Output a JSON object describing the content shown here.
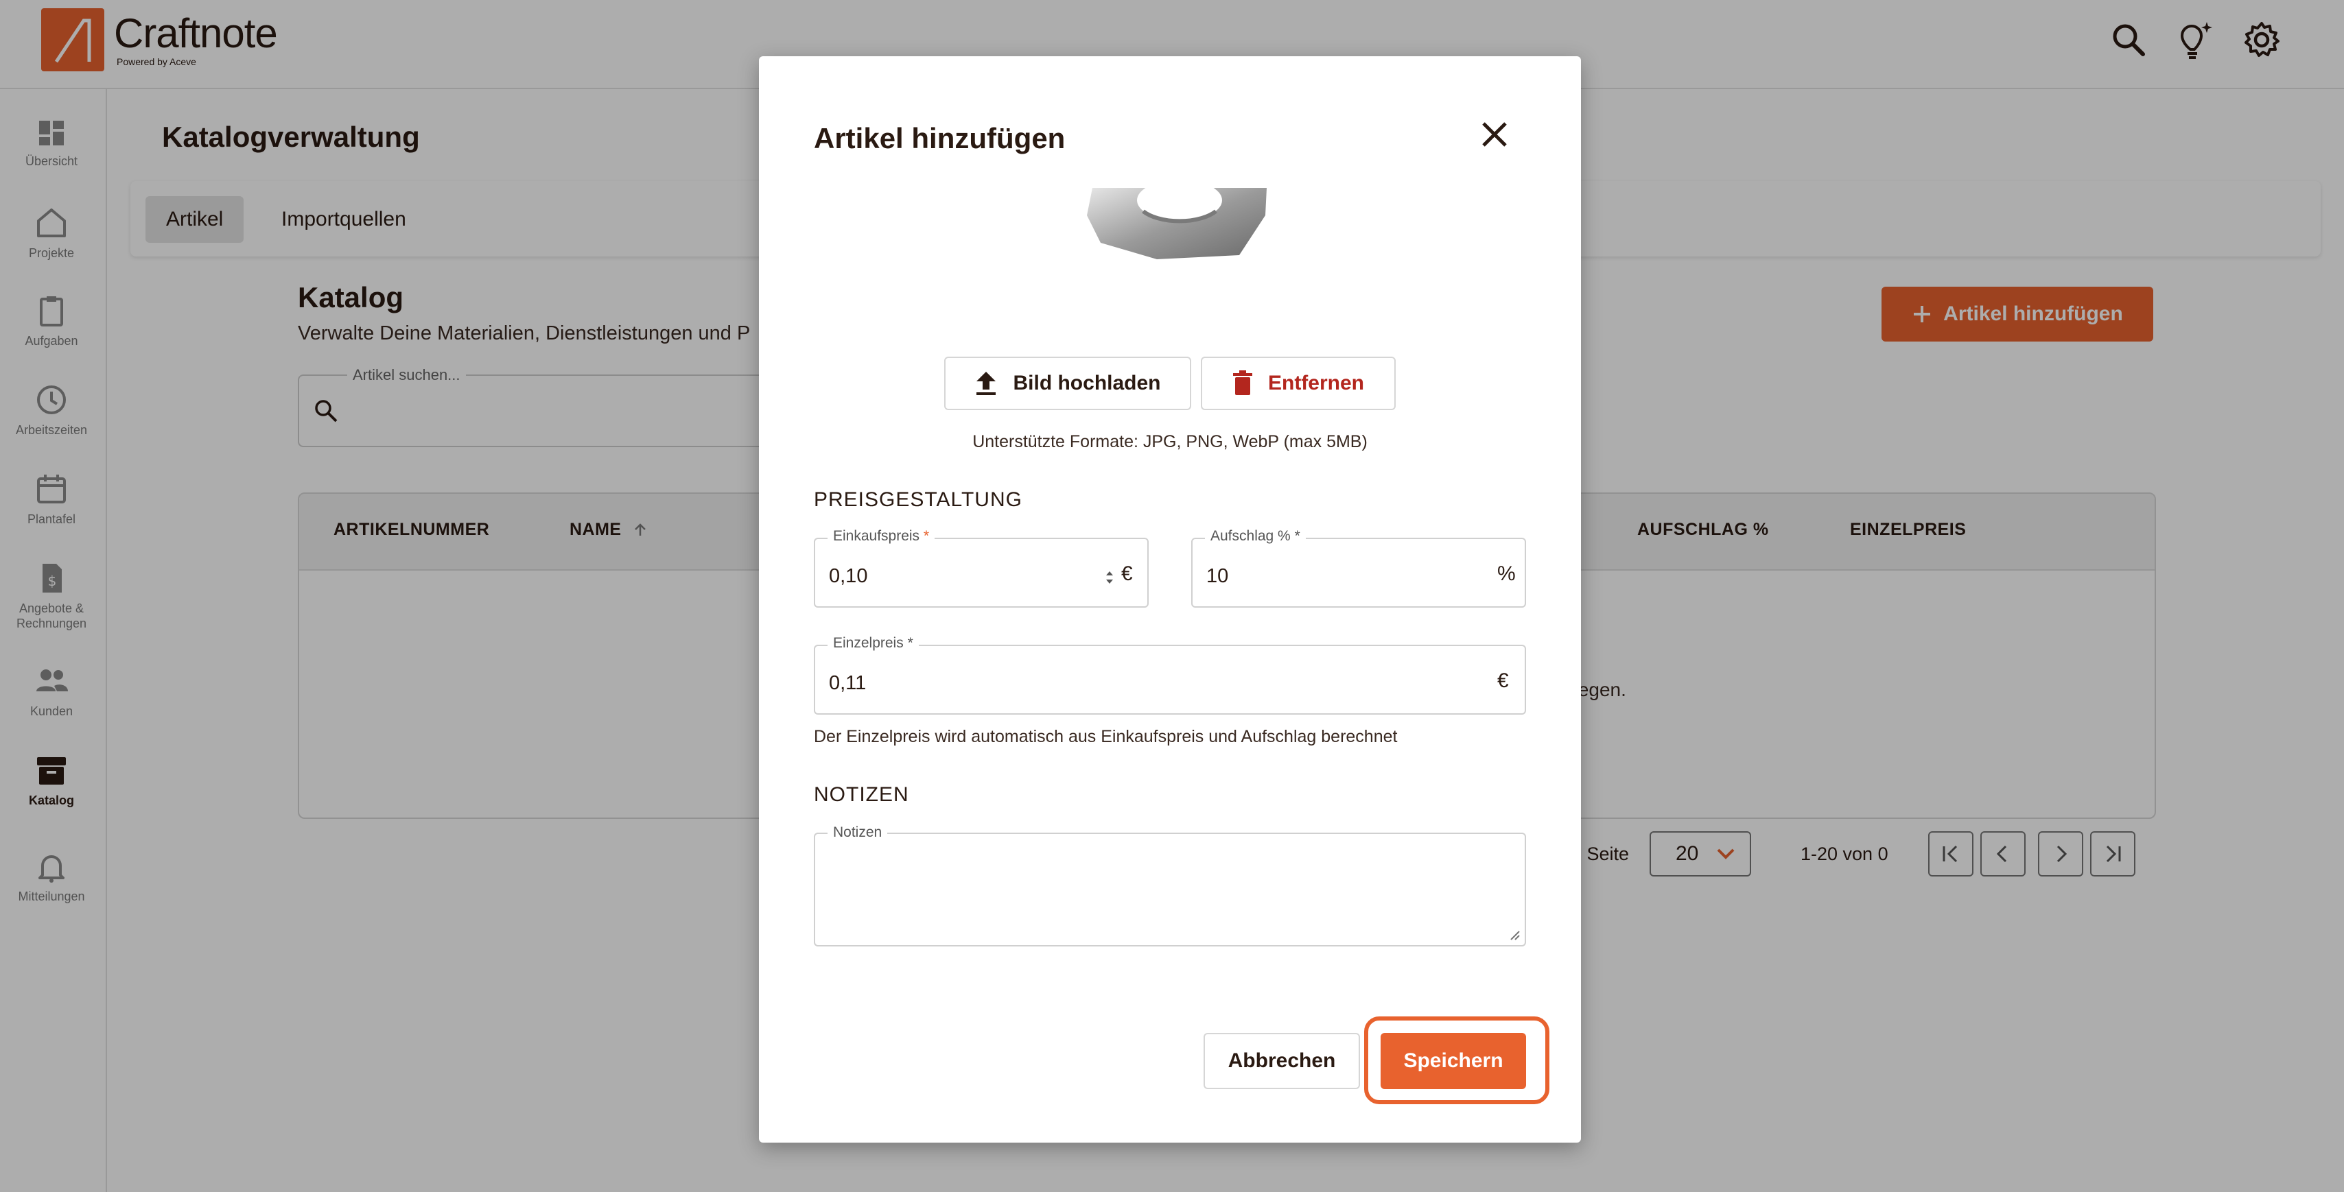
{
  "brand": {
    "name": "Craftnote",
    "tagline": "Powered by Aceve"
  },
  "sidebar": {
    "items": [
      {
        "label": "Übersicht"
      },
      {
        "label": "Projekte"
      },
      {
        "label": "Aufgaben"
      },
      {
        "label": "Arbeitszeiten"
      },
      {
        "label": "Plantafel"
      },
      {
        "label": "Angebote & Rechnungen"
      },
      {
        "label": "Kunden"
      },
      {
        "label": "Katalog",
        "active": true
      },
      {
        "label": "Mitteilungen"
      }
    ]
  },
  "page": {
    "title": "Katalogverwaltung",
    "tabs": [
      {
        "label": "Artikel",
        "active": true
      },
      {
        "label": "Importquellen"
      }
    ]
  },
  "catalog": {
    "title": "Katalog",
    "subtitle": "Verwalte Deine Materialien, Dienstleistungen und P",
    "add_button": "Artikel hinzufügen",
    "search_label": "Artikel suchen...",
    "columns": [
      "ARTIKELNUMMER",
      "NAME",
      "AUFSCHLAG %",
      "EINZELPREIS"
    ],
    "empty_message": "ulegen.",
    "pagination": {
      "per_page_label": "o Seite",
      "per_page": "20",
      "range": "1-20 von 0"
    }
  },
  "modal": {
    "title": "Artikel hinzufügen",
    "upload_button": "Bild hochladen",
    "remove_button": "Entfernen",
    "formats_hint": "Unterstützte Formate: JPG, PNG, WebP (max 5MB)",
    "pricing_section": "PREISGESTALTUNG",
    "purchase_price": {
      "label": "Einkaufspreis",
      "required": "*",
      "value": "0,10",
      "unit": "€"
    },
    "markup": {
      "label": "Aufschlag %",
      "required": "*",
      "value": "10",
      "unit": "%"
    },
    "unit_price": {
      "label": "Einzelpreis",
      "required": "*",
      "value": "0,11",
      "unit": "€"
    },
    "unit_price_hint": "Der Einzelpreis wird automatisch aus Einkaufspreis und Aufschlag berechnet",
    "notes_section": "NOTIZEN",
    "notes": {
      "label": "Notizen",
      "value": ""
    },
    "cancel_button": "Abbrechen",
    "save_button": "Speichern"
  },
  "colors": {
    "accent": "#e8622e",
    "danger": "#b3261e",
    "text": "#2a1a12"
  }
}
